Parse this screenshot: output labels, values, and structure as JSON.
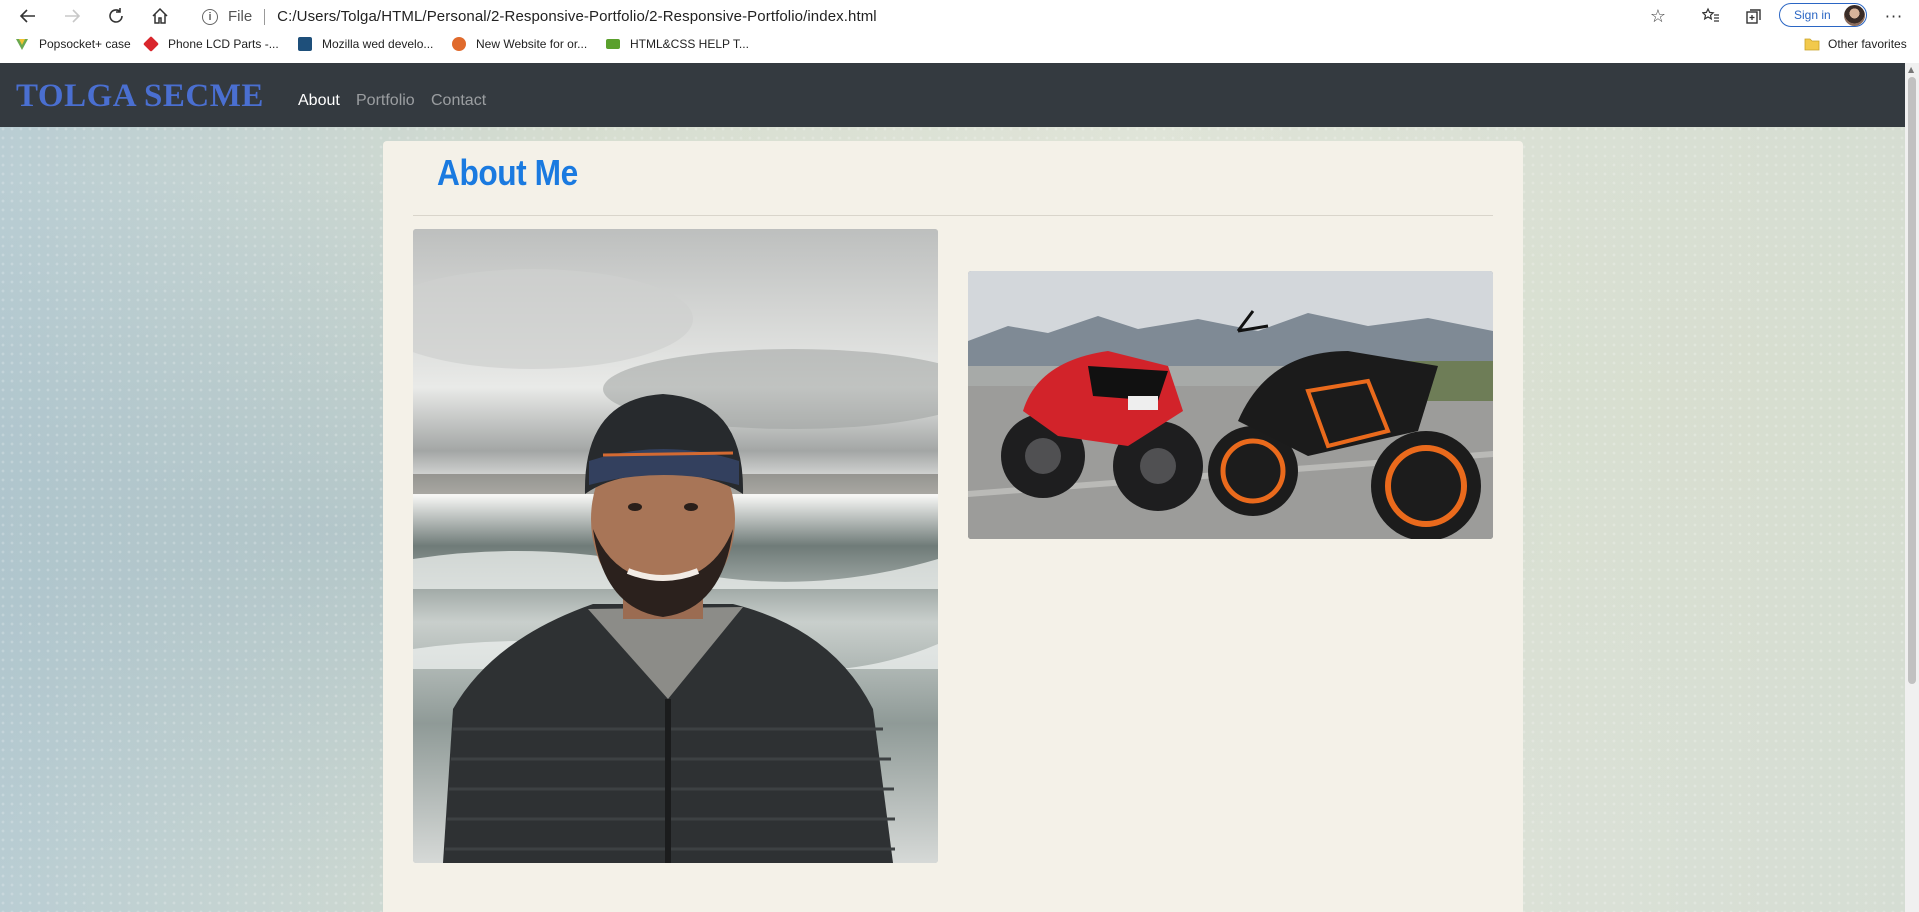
{
  "browser": {
    "address_scheme": "File",
    "url": "C:/Users/Tolga/HTML/Personal/2-Responsive-Portfolio/2-Responsive-Portfolio/index.html",
    "sign_in_label": "Sign in",
    "icons": {
      "back": "back-arrow-icon",
      "forward": "forward-arrow-icon",
      "refresh": "refresh-icon",
      "home": "home-icon",
      "info": "info-icon",
      "favorite": "star-icon",
      "favorites_list": "favorites-list-icon",
      "collections": "collections-icon",
      "more": "more-icon"
    }
  },
  "bookmarks": {
    "items": [
      {
        "label": "Popsocket+ case",
        "color": "#6aa84f"
      },
      {
        "label": "Phone LCD Parts -...",
        "color": "#d9262c"
      },
      {
        "label": "Mozilla wed develo...",
        "color": "#1e4f7a"
      },
      {
        "label": "New Website for or...",
        "color": "#e06a2c"
      },
      {
        "label": "HTML&CSS HELP T...",
        "color": "#5aa02c"
      }
    ],
    "other_label": "Other favorites"
  },
  "site": {
    "brand": "TOLGA SECME",
    "nav": [
      {
        "label": "About",
        "active": true
      },
      {
        "label": "Portfolio",
        "active": false
      },
      {
        "label": "Contact",
        "active": false
      }
    ],
    "card_title": "About Me",
    "colors": {
      "navbar": "#343a40",
      "brand": "#4a6fd1",
      "title": "#1a7ae0",
      "card": "#f4f1e8"
    }
  }
}
